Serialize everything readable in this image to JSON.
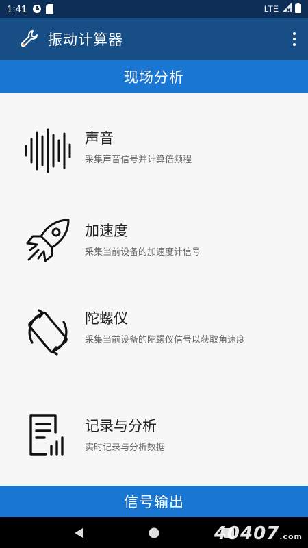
{
  "status_bar": {
    "time": "1:41",
    "network": "LTE"
  },
  "app_bar": {
    "title": "振动计算器",
    "icon": "wrench-icon",
    "menu_icon": "more-vert-icon"
  },
  "section_top": {
    "label": "现场分析"
  },
  "items": [
    {
      "title": "声音",
      "desc": "采集声音信号并计算倍频程",
      "icon": "sound-wave-icon"
    },
    {
      "title": "加速度",
      "desc": "采集当前设备的加速度计信号",
      "icon": "rocket-icon"
    },
    {
      "title": "陀螺仪",
      "desc": "采集当前设备的陀螺仪信号以获取角速度",
      "icon": "screen-rotation-icon"
    },
    {
      "title": "记录与分析",
      "desc": "实时记录与分析数据",
      "icon": "report-chart-icon"
    }
  ],
  "section_bottom": {
    "label": "信号输出"
  },
  "nav": {
    "back": "back-icon",
    "home": "home-icon",
    "recents": "recents-icon"
  },
  "watermark": {
    "text": "40407",
    "suffix": ".com"
  },
  "colors": {
    "status_bar": "#0d2f57",
    "app_bar": "#174e85",
    "section_header": "#1976d2",
    "list_bg": "#f7f7f7"
  }
}
